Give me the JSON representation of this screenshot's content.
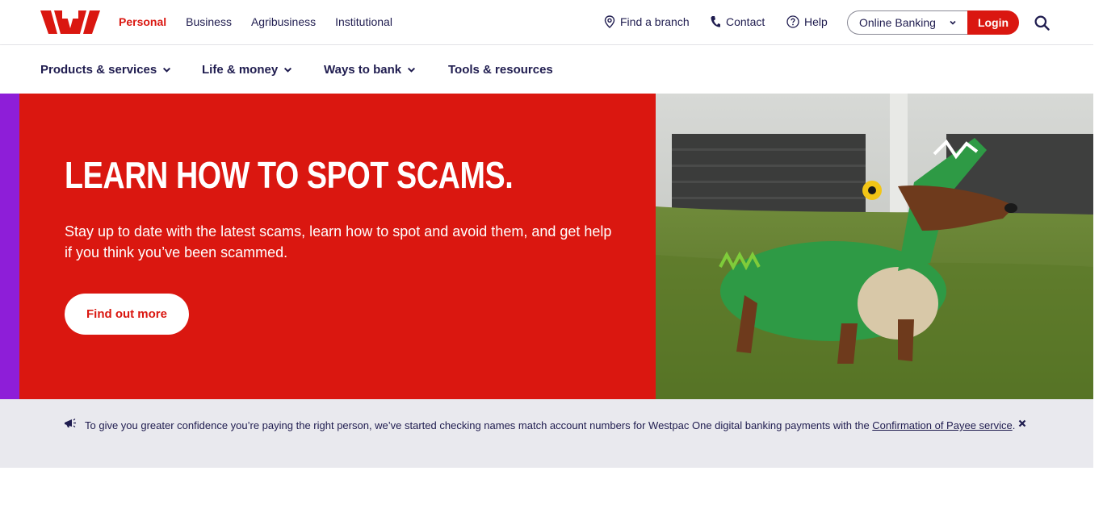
{
  "brand_nav": [
    "Personal",
    "Business",
    "Agribusiness",
    "Institutional"
  ],
  "utility": {
    "find_branch": "Find a branch",
    "contact": "Contact",
    "help": "Help",
    "online_banking": "Online Banking",
    "login": "Login"
  },
  "main_nav": [
    "Products & services",
    "Life & money",
    "Ways to bank",
    "Tools & resources"
  ],
  "hero": {
    "title": "LEARN HOW TO SPOT SCAMS.",
    "text": "Stay up to date with the latest scams, learn how to spot and avoid them, and get help if you think you’ve been scammed.",
    "button": "Find out more"
  },
  "notice": {
    "text": "To give you greater confidence you’re paying the right person, we’ve started checking names match account numbers for Westpac One digital banking payments with the ",
    "link": "Confirmation of Payee service",
    "end": "."
  },
  "colors": {
    "brand_red": "#da1710",
    "accent_purple": "#8e1ed8",
    "navy": "#1f1c4f"
  },
  "icons": [
    "westpac-logo",
    "location-pin-icon",
    "phone-icon",
    "help-circle-icon",
    "chevron-down-icon",
    "search-icon",
    "megaphone-icon",
    "close-icon"
  ]
}
